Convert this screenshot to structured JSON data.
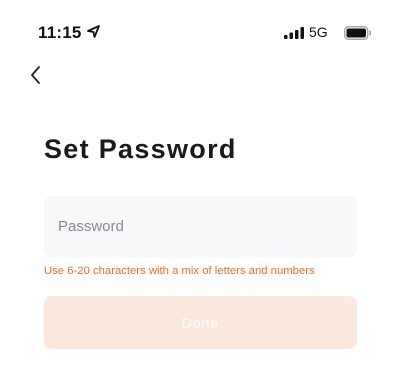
{
  "status_bar": {
    "time": "11:15",
    "network": "5G",
    "icons": [
      "location-arrow-icon",
      "signal-bars-icon",
      "battery-icon"
    ]
  },
  "nav": {
    "back_icon": "chevron-left-icon"
  },
  "page": {
    "title": "Set Password"
  },
  "form": {
    "password": {
      "value": "",
      "placeholder": "Password"
    },
    "hint": "Use 6-20 characters with a mix of letters and numbers",
    "done_label": "Done",
    "done_enabled": false
  },
  "colors": {
    "accent": "#f06a30",
    "button_disabled_bg": "#fde8de",
    "field_bg": "#f7f8fa",
    "title": "#1a1a1a"
  }
}
